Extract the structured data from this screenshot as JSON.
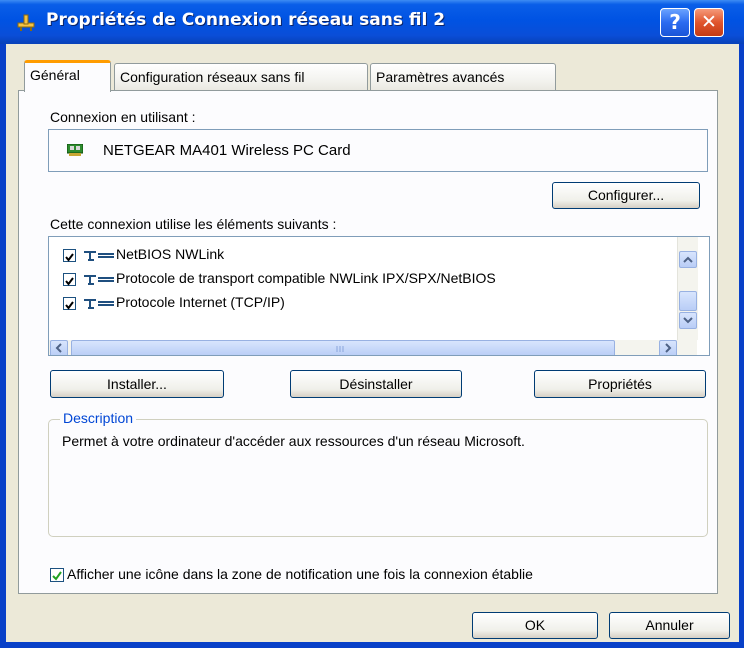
{
  "window": {
    "title": "Propriétés de Connexion réseau sans fil 2",
    "help": "?",
    "close": "✕"
  },
  "tabs": [
    {
      "label": "Général",
      "active": true
    },
    {
      "label": "Configuration réseaux sans fil",
      "active": false
    },
    {
      "label": "Paramètres avancés",
      "active": false
    }
  ],
  "connect_using": {
    "label": "Connexion en utilisant :",
    "adapter": "NETGEAR MA401 Wireless PC Card",
    "configure_button": "Configurer..."
  },
  "components": {
    "label": "Cette connexion utilise les éléments suivants :",
    "items": [
      {
        "label": "NetBIOS NWLink",
        "checked": true,
        "icon": "network-protocol-icon"
      },
      {
        "label": "Protocole de transport compatible NWLink IPX/SPX/NetBIOS",
        "checked": true,
        "icon": "network-protocol-icon"
      },
      {
        "label": "Protocole Internet (TCP/IP)",
        "checked": true,
        "icon": "network-protocol-icon"
      }
    ]
  },
  "actions": {
    "install": "Installer...",
    "uninstall": "Désinstaller",
    "properties": "Propriétés"
  },
  "description": {
    "title": "Description",
    "text": "Permet à votre ordinateur d'accéder aux ressources d'un réseau Microsoft."
  },
  "notify": {
    "label": "Afficher une icône dans la zone de notification une fois la connexion établie",
    "checked": true
  },
  "footer": {
    "ok": "OK",
    "cancel": "Annuler"
  },
  "colors": {
    "titlebar": "#0053e3",
    "frame": "#0840c8",
    "dialog_bg": "#ece9d8",
    "group_title": "#0046d5",
    "tab_highlight": "#ff9c00",
    "close_button": "#e0552d"
  }
}
